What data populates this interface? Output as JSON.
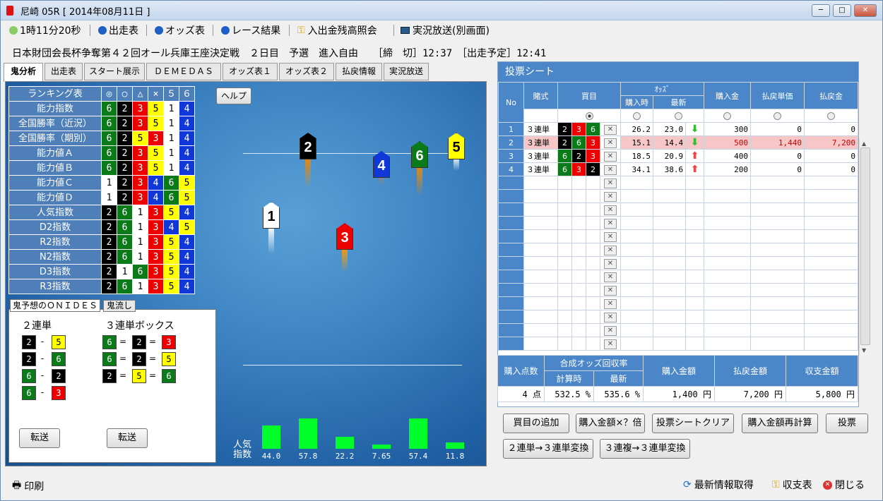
{
  "window": {
    "title": "尼崎 05R [ 2014年08月11日 ]",
    "min": "─",
    "max": "□",
    "close": "✕"
  },
  "toolbar": {
    "timer": "1時11分20秒",
    "entry": "出走表",
    "odds": "オッズ表",
    "result": "レース結果",
    "balance": "入出金残高照会",
    "live": "実況放送(別画面)"
  },
  "race": {
    "header": "日本財団会長杯争奪第４２回オール兵庫王座決定戦　２日目　予選　進入自由　　［締　切］12:37　［出走予定］12:41"
  },
  "tabs": [
    "鬼分析",
    "出走表",
    "スタート展示",
    "ＤＥＭＥＤＡＳ",
    "オッズ表１",
    "オッズ表２",
    "払戻情報",
    "実況放送"
  ],
  "ranking": {
    "header": [
      "ランキング表",
      "◎",
      "○",
      "△",
      "×",
      "５",
      "６"
    ],
    "rows": [
      {
        "label": "能力指数",
        "v": [
          6,
          2,
          3,
          5,
          1,
          4
        ]
      },
      {
        "label": "全国勝率（近況）",
        "v": [
          6,
          2,
          3,
          5,
          1,
          4
        ]
      },
      {
        "label": "全国勝率（期別）",
        "v": [
          6,
          2,
          5,
          3,
          1,
          4
        ]
      },
      {
        "label": "能力値Ａ",
        "v": [
          6,
          2,
          3,
          5,
          1,
          4
        ]
      },
      {
        "label": "能力値Ｂ",
        "v": [
          6,
          2,
          3,
          5,
          1,
          4
        ]
      },
      {
        "label": "能力値Ｃ",
        "v": [
          1,
          2,
          3,
          4,
          6,
          5
        ]
      },
      {
        "label": "能力値Ｄ",
        "v": [
          1,
          2,
          3,
          4,
          6,
          5
        ]
      },
      {
        "label": "人気指数",
        "v": [
          2,
          6,
          1,
          3,
          5,
          4
        ]
      },
      {
        "label": "D2指数",
        "v": [
          2,
          6,
          1,
          3,
          4,
          5
        ]
      },
      {
        "label": "R2指数",
        "v": [
          2,
          6,
          1,
          3,
          5,
          4
        ]
      },
      {
        "label": "N2指数",
        "v": [
          2,
          6,
          1,
          3,
          5,
          4
        ]
      },
      {
        "label": "D3指数",
        "v": [
          2,
          1,
          6,
          3,
          5,
          4
        ]
      },
      {
        "label": "R3指数",
        "v": [
          2,
          6,
          1,
          3,
          5,
          4
        ]
      }
    ]
  },
  "help": "ヘルプ",
  "boats": [
    "1",
    "2",
    "3",
    "4",
    "5",
    "6"
  ],
  "prediction": {
    "tab1": "鬼予想のＯＮＩＤＥＳ",
    "tab2": "鬼流し",
    "col1": "２連単",
    "col2": "３連単ボックス",
    "exacta": [
      [
        2,
        5
      ],
      [
        2,
        6
      ],
      [
        6,
        2
      ],
      [
        6,
        3
      ]
    ],
    "trifecta": [
      [
        6,
        2,
        3
      ],
      [
        6,
        2,
        5
      ],
      [
        2,
        5,
        6
      ]
    ],
    "dash": "-",
    "eq": "=",
    "transfer": "転送"
  },
  "popularity": {
    "label1": "人気",
    "label2": "指数",
    "values": [
      "44.0",
      "57.8",
      "22.2",
      "7.65",
      "57.4",
      "11.8"
    ]
  },
  "chart_data": {
    "type": "bar",
    "categories": [
      "1",
      "2",
      "3",
      "4",
      "5",
      "6"
    ],
    "values": [
      44.0,
      57.8,
      22.2,
      7.65,
      57.4,
      11.8
    ],
    "xlabel": "",
    "ylabel": "人気指数"
  },
  "sheet": {
    "title": "投票シート",
    "h_no": "No",
    "h_type": "賭式",
    "h_combo": "買目",
    "h_odds": "ｵｯｽﾞ",
    "h_time": "購入時",
    "h_latest": "最新",
    "h_amount": "購入金",
    "h_unit": "払戻単価",
    "h_payout": "払戻金",
    "rows": [
      {
        "no": "1",
        "type": "３連単",
        "c": [
          2,
          3,
          6
        ],
        "x": "✕",
        "t": "26.2",
        "l": "23.0",
        "dir": "down",
        "amt": "300",
        "unit": "0",
        "pay": "0"
      },
      {
        "no": "2",
        "type": "３連単",
        "c": [
          2,
          6,
          3
        ],
        "x": "✕",
        "t": "15.1",
        "l": "14.4",
        "dir": "down",
        "amt": "500",
        "unit": "1,440",
        "pay": "7,200"
      },
      {
        "no": "3",
        "type": "３連単",
        "c": [
          6,
          2,
          3
        ],
        "x": "✕",
        "t": "18.5",
        "l": "20.9",
        "dir": "up",
        "amt": "400",
        "unit": "0",
        "pay": "0"
      },
      {
        "no": "4",
        "type": "３連単",
        "c": [
          6,
          3,
          2
        ],
        "x": "✕",
        "t": "34.1",
        "l": "38.6",
        "dir": "up",
        "amt": "200",
        "unit": "0",
        "pay": "0"
      }
    ]
  },
  "summary": {
    "h_points": "購入点数",
    "h_rate": "合成オッズ回収率",
    "h_calc": "計算時",
    "h_latest": "最新",
    "h_amount": "購入金額",
    "h_payout": "払戻金額",
    "h_balance": "収支金額",
    "points": "4 点",
    "calc": "532.5 %",
    "latest": "535.6 %",
    "amount": "1,400 円",
    "payout": "7,200 円",
    "balance": "5,800 円"
  },
  "actions": {
    "add": "買目の追加",
    "mult": "購入金額×？倍",
    "clear": "投票シートクリア",
    "recalc": "購入金額再計算",
    "vote": "投票",
    "conv1": "２連単→３連単変換",
    "conv2": "３連複→３連単変換"
  },
  "footer": {
    "print": "印刷",
    "refresh": "最新情報取得",
    "ledger": "収支表",
    "close": "閉じる"
  }
}
